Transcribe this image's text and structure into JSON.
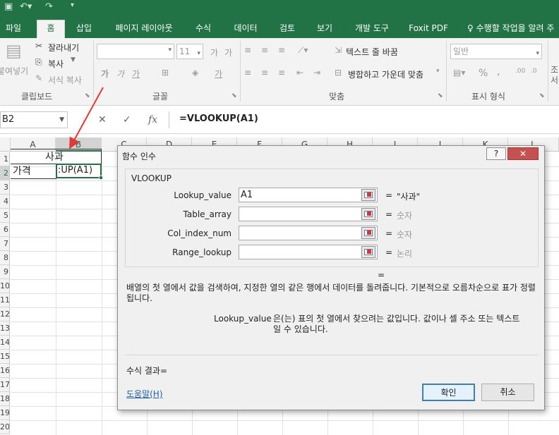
{
  "tabs": [
    "파일",
    "홈",
    "삽입",
    "페이지 레이아웃",
    "수식",
    "데이터",
    "검토",
    "보기",
    "개발 도구",
    "Foxit PDF",
    "수행할 작업을 알려 주"
  ],
  "ribbon": {
    "clipboard": {
      "paste": "붙여넣기",
      "cut": "잘라내기",
      "copy": "복사",
      "format_painter": "서식 복사",
      "label": "클립보드"
    },
    "font": {
      "size": "11",
      "grow": "가",
      "shrink": "가",
      "bold": "가",
      "italic": "가",
      "underline": "가",
      "font_color": "가",
      "label": "글꼴"
    },
    "alignment": {
      "wrap": "텍스트 줄 바꿈",
      "merge": "병합하고 가운데 맞춤",
      "label": "맞춤"
    },
    "number": {
      "format": "일반",
      "percent": "%",
      "comma": ",",
      "label": "표시 형식",
      "cut_text": "조\n서"
    }
  },
  "formula_bar": {
    "name_box": "B2",
    "cancel": "✕",
    "enter": "✓",
    "fx": "fx",
    "formula": "=VLOOKUP(A1)"
  },
  "grid": {
    "columns": [
      "A",
      "B",
      "C",
      "D",
      "E",
      "F",
      "G",
      "H",
      "I",
      "J",
      "K",
      "L"
    ],
    "rows": [
      "1",
      "2",
      "3",
      "4",
      "5",
      "6",
      "7",
      "8",
      "9",
      "10",
      "11",
      "12",
      "13",
      "14",
      "15",
      "16",
      "17",
      "18",
      "19",
      "20"
    ],
    "cells": {
      "B1": "사과",
      "A2": "가격",
      "B2": ":UP(A1)"
    }
  },
  "dialog": {
    "title": "함수 인수",
    "help_btn": "?",
    "close_btn": "✕",
    "function_name": "VLOOKUP",
    "args": [
      {
        "name": "Lookup_value",
        "value": "A1",
        "result": "\"사과\""
      },
      {
        "name": "Table_array",
        "value": "",
        "result": "숫자"
      },
      {
        "name": "Col_index_num",
        "value": "",
        "result": "숫자"
      },
      {
        "name": "Range_lookup",
        "value": "",
        "result": "논리"
      }
    ],
    "eq": "=",
    "description": "배열의 첫 열에서 값을 검색하여, 지정한 열의 같은 행에서 데이터를 돌려줍니다. 기본적으로 오름차순으로 표가 정렬됩니다.",
    "arg_name": "Lookup_value",
    "arg_description": "은(는) 표의 첫 열에서 찾으려는 값입니다. 값이나 셀 주소 또는 텍스트일 수 있습니다.",
    "formula_result_label": "수식 결과=",
    "help_link": "도움말(H)",
    "ok": "확인",
    "cancel": "취소"
  },
  "colors": {
    "excel_green": "#217346",
    "annotation_arrow": "#e53935"
  }
}
